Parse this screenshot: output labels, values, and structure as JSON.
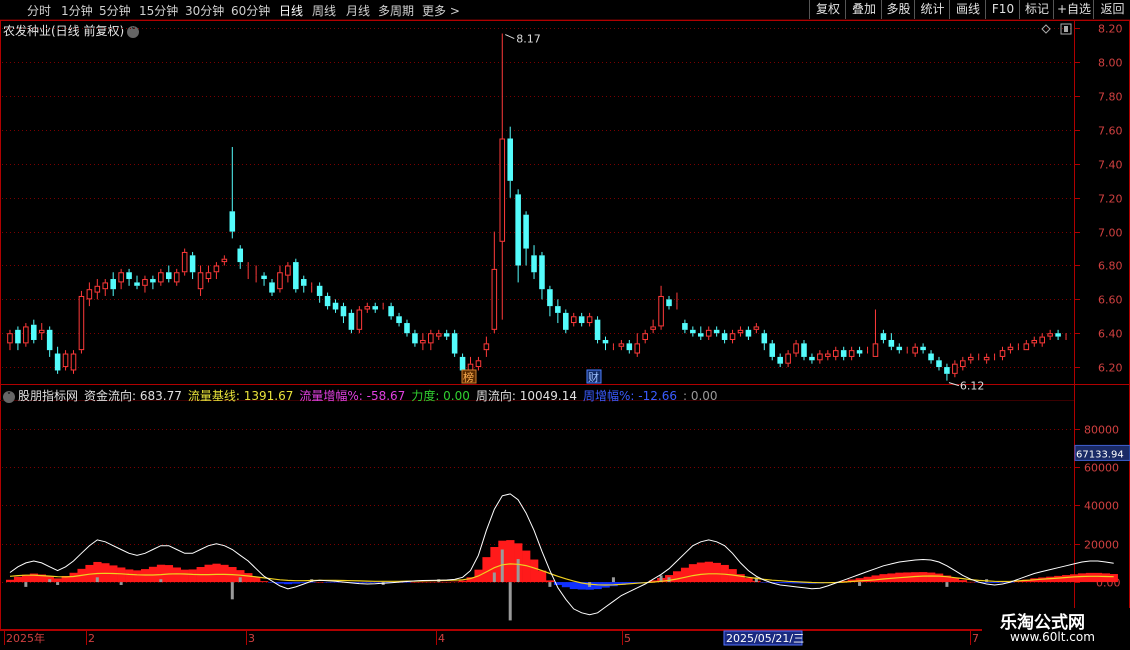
{
  "toolbar": {
    "periods": [
      "分时",
      "1分钟",
      "5分钟",
      "15分钟",
      "30分钟",
      "60分钟",
      "日线",
      "周线",
      "月线",
      "多周期",
      "更多 >"
    ],
    "active": "日线",
    "right_buttons": [
      "复权",
      "叠加",
      "多股",
      "统计",
      "画线",
      "F10",
      "标记",
      "+自选",
      "返回"
    ]
  },
  "stock_title": "农发种业(日线 前复权)",
  "price_axis": [
    "8.20",
    "8.00",
    "7.80",
    "7.60",
    "7.40",
    "7.20",
    "7.00",
    "6.80",
    "6.60",
    "6.40",
    "6.20"
  ],
  "high_label": "8.17",
  "low_label": "6.12",
  "badges": [
    "榜",
    "财"
  ],
  "indicator": {
    "name": "股朋指标网",
    "fields": [
      {
        "label": "资金流向: 683.77",
        "color": "#e0e0e0"
      },
      {
        "label": "流量基线: 1391.67",
        "color": "#e8e23a"
      },
      {
        "label": "流量增幅%: -58.67",
        "color": "#e040e0"
      },
      {
        "label": "力度: 0.00",
        "color": "#30d030"
      },
      {
        "label": "周流向: 10049.14",
        "color": "#e0e0e0"
      },
      {
        "label": "周增幅%: -12.66",
        "color": "#3a5cff"
      },
      {
        "label": ": 0.00",
        "color": "#999999"
      }
    ],
    "axis": [
      "80000",
      "60000",
      "40000",
      "20000",
      "0.00"
    ],
    "current_value": "67133.94"
  },
  "date_axis": {
    "labels": [
      "2025年",
      "2",
      "3",
      "4",
      "5",
      "7"
    ],
    "highlight": "2025/05/21/三"
  },
  "watermark": {
    "line1": "乐淘公式网",
    "line2": "www.60lt.com"
  },
  "colors": {
    "up": "#ff3a3a",
    "down": "#54fcfc",
    "grid": "#7a0000",
    "axis": "#b00000",
    "flow": "#ffffff",
    "base": "#f0d020"
  },
  "chart_data": {
    "type": "candlestick",
    "title": "农发种业(日线 前复权)",
    "ylim": [
      6.1,
      8.25
    ],
    "annotations": [
      {
        "label": "8.17",
        "value": 8.17
      },
      {
        "label": "6.12",
        "value": 6.12
      }
    ],
    "candles": [
      [
        6.34,
        6.4,
        6.42,
        6.3
      ],
      [
        6.42,
        6.34,
        6.44,
        6.3
      ],
      [
        6.34,
        6.44,
        6.46,
        6.32
      ],
      [
        6.45,
        6.36,
        6.48,
        6.34
      ],
      [
        6.4,
        6.42,
        6.46,
        6.36
      ],
      [
        6.42,
        6.3,
        6.44,
        6.26
      ],
      [
        6.28,
        6.18,
        6.32,
        6.16
      ],
      [
        6.2,
        6.28,
        6.3,
        6.18
      ],
      [
        6.18,
        6.28,
        6.3,
        6.16
      ],
      [
        6.3,
        6.62,
        6.65,
        6.28
      ],
      [
        6.6,
        6.66,
        6.7,
        6.56
      ],
      [
        6.64,
        6.68,
        6.72,
        6.6
      ],
      [
        6.66,
        6.7,
        6.72,
        6.62
      ],
      [
        6.72,
        6.66,
        6.76,
        6.62
      ],
      [
        6.7,
        6.76,
        6.78,
        6.66
      ],
      [
        6.76,
        6.72,
        6.78,
        6.68
      ],
      [
        6.7,
        6.68,
        6.74,
        6.66
      ],
      [
        6.68,
        6.72,
        6.74,
        6.64
      ],
      [
        6.72,
        6.7,
        6.74,
        6.66
      ],
      [
        6.7,
        6.76,
        6.78,
        6.68
      ],
      [
        6.76,
        6.72,
        6.8,
        6.7
      ],
      [
        6.7,
        6.76,
        6.78,
        6.68
      ],
      [
        6.76,
        6.88,
        6.9,
        6.74
      ],
      [
        6.86,
        6.76,
        6.88,
        6.72
      ],
      [
        6.66,
        6.76,
        6.8,
        6.62
      ],
      [
        6.72,
        6.76,
        6.8,
        6.7
      ],
      [
        6.76,
        6.8,
        6.82,
        6.72
      ],
      [
        6.82,
        6.84,
        6.86,
        6.8
      ],
      [
        7.12,
        7.0,
        7.5,
        6.96
      ],
      [
        6.9,
        6.82,
        6.92,
        6.78
      ],
      [
        6.78,
        6.78,
        6.82,
        6.72
      ],
      [
        6.74,
        6.74,
        6.8,
        6.7
      ],
      [
        6.74,
        6.72,
        6.76,
        6.68
      ],
      [
        6.7,
        6.64,
        6.72,
        6.62
      ],
      [
        6.66,
        6.76,
        6.8,
        6.64
      ],
      [
        6.74,
        6.8,
        6.82,
        6.7
      ],
      [
        6.82,
        6.66,
        6.84,
        6.64
      ],
      [
        6.72,
        6.68,
        6.74,
        6.64
      ],
      [
        6.68,
        6.68,
        6.7,
        6.64
      ],
      [
        6.68,
        6.62,
        6.7,
        6.58
      ],
      [
        6.62,
        6.56,
        6.64,
        6.54
      ],
      [
        6.58,
        6.54,
        6.6,
        6.52
      ],
      [
        6.56,
        6.5,
        6.58,
        6.46
      ],
      [
        6.52,
        6.42,
        6.54,
        6.4
      ],
      [
        6.42,
        6.54,
        6.56,
        6.4
      ],
      [
        6.54,
        6.56,
        6.58,
        6.52
      ],
      [
        6.56,
        6.54,
        6.58,
        6.52
      ],
      [
        6.56,
        6.56,
        6.58,
        6.54
      ],
      [
        6.56,
        6.5,
        6.58,
        6.48
      ],
      [
        6.5,
        6.46,
        6.52,
        6.44
      ],
      [
        6.46,
        6.4,
        6.48,
        6.38
      ],
      [
        6.4,
        6.34,
        6.42,
        6.32
      ],
      [
        6.34,
        6.36,
        6.4,
        6.3
      ],
      [
        6.34,
        6.4,
        6.42,
        6.3
      ],
      [
        6.38,
        6.4,
        6.42,
        6.36
      ],
      [
        6.4,
        6.38,
        6.42,
        6.36
      ],
      [
        6.4,
        6.28,
        6.42,
        6.26
      ],
      [
        6.26,
        6.18,
        6.28,
        6.16
      ],
      [
        6.18,
        6.22,
        6.26,
        6.16
      ],
      [
        6.2,
        6.24,
        6.26,
        6.18
      ],
      [
        6.3,
        6.34,
        6.38,
        6.26
      ],
      [
        6.42,
        6.78,
        7.0,
        6.4
      ],
      [
        6.94,
        7.55,
        8.17,
        6.48
      ],
      [
        7.55,
        7.3,
        7.62,
        7.2
      ],
      [
        7.22,
        6.8,
        7.25,
        6.7
      ],
      [
        7.1,
        6.9,
        7.12,
        6.8
      ],
      [
        6.86,
        6.76,
        6.92,
        6.72
      ],
      [
        6.86,
        6.66,
        6.88,
        6.6
      ],
      [
        6.66,
        6.56,
        6.68,
        6.5
      ],
      [
        6.56,
        6.52,
        6.6,
        6.46
      ],
      [
        6.52,
        6.42,
        6.54,
        6.4
      ],
      [
        6.46,
        6.5,
        6.52,
        6.44
      ],
      [
        6.5,
        6.46,
        6.52,
        6.44
      ],
      [
        6.46,
        6.5,
        6.52,
        6.44
      ],
      [
        6.48,
        6.36,
        6.5,
        6.34
      ],
      [
        6.36,
        6.34,
        6.38,
        6.3
      ],
      [
        6.32,
        6.32,
        6.34,
        6.3
      ],
      [
        6.32,
        6.34,
        6.36,
        6.3
      ],
      [
        6.34,
        6.3,
        6.36,
        6.28
      ],
      [
        6.28,
        6.34,
        6.4,
        6.26
      ],
      [
        6.36,
        6.4,
        6.42,
        6.34
      ],
      [
        6.42,
        6.44,
        6.48,
        6.4
      ],
      [
        6.44,
        6.62,
        6.68,
        6.42
      ],
      [
        6.6,
        6.56,
        6.62,
        6.54
      ],
      [
        6.58,
        6.58,
        6.64,
        6.54
      ],
      [
        6.46,
        6.42,
        6.48,
        6.4
      ],
      [
        6.42,
        6.4,
        6.44,
        6.38
      ],
      [
        6.4,
        6.38,
        6.44,
        6.36
      ],
      [
        6.38,
        6.42,
        6.44,
        6.36
      ],
      [
        6.42,
        6.4,
        6.44,
        6.38
      ],
      [
        6.4,
        6.36,
        6.42,
        6.34
      ],
      [
        6.36,
        6.4,
        6.42,
        6.34
      ],
      [
        6.4,
        6.42,
        6.44,
        6.38
      ],
      [
        6.42,
        6.38,
        6.44,
        6.36
      ],
      [
        6.42,
        6.44,
        6.46,
        6.4
      ],
      [
        6.4,
        6.34,
        6.42,
        6.3
      ],
      [
        6.34,
        6.26,
        6.36,
        6.24
      ],
      [
        6.26,
        6.22,
        6.28,
        6.2
      ],
      [
        6.22,
        6.28,
        6.3,
        6.2
      ],
      [
        6.28,
        6.34,
        6.36,
        6.26
      ],
      [
        6.34,
        6.26,
        6.36,
        6.24
      ],
      [
        6.26,
        6.24,
        6.28,
        6.22
      ],
      [
        6.24,
        6.28,
        6.3,
        6.22
      ],
      [
        6.26,
        6.28,
        6.3,
        6.24
      ],
      [
        6.26,
        6.3,
        6.32,
        6.24
      ],
      [
        6.3,
        6.26,
        6.32,
        6.24
      ],
      [
        6.26,
        6.3,
        6.32,
        6.24
      ],
      [
        6.3,
        6.28,
        6.32,
        6.26
      ],
      [
        6.3,
        6.3,
        6.32,
        6.28
      ],
      [
        6.26,
        6.34,
        6.54,
        6.26
      ],
      [
        6.4,
        6.36,
        6.42,
        6.34
      ],
      [
        6.36,
        6.32,
        6.4,
        6.3
      ],
      [
        6.32,
        6.3,
        6.34,
        6.28
      ],
      [
        6.3,
        6.3,
        6.32,
        6.28
      ],
      [
        6.28,
        6.32,
        6.34,
        6.26
      ],
      [
        6.32,
        6.3,
        6.34,
        6.28
      ],
      [
        6.28,
        6.24,
        6.3,
        6.22
      ],
      [
        6.24,
        6.2,
        6.26,
        6.18
      ],
      [
        6.2,
        6.16,
        6.22,
        6.12
      ],
      [
        6.16,
        6.22,
        6.24,
        6.14
      ],
      [
        6.2,
        6.24,
        6.26,
        6.18
      ],
      [
        6.24,
        6.26,
        6.28,
        6.22
      ],
      [
        6.26,
        6.26,
        6.28,
        6.24
      ],
      [
        6.24,
        6.26,
        6.28,
        6.22
      ],
      [
        6.26,
        6.26,
        6.28,
        6.24
      ],
      [
        6.26,
        6.3,
        6.32,
        6.24
      ],
      [
        6.3,
        6.32,
        6.34,
        6.28
      ],
      [
        6.32,
        6.32,
        6.34,
        6.3
      ],
      [
        6.3,
        6.34,
        6.36,
        6.3
      ],
      [
        6.34,
        6.36,
        6.38,
        6.32
      ],
      [
        6.34,
        6.38,
        6.4,
        6.32
      ],
      [
        6.38,
        6.4,
        6.42,
        6.36
      ],
      [
        6.4,
        6.38,
        6.42,
        6.36
      ],
      [
        6.38,
        6.38,
        6.4,
        6.36
      ]
    ],
    "indicator": {
      "ylim": [
        -25000,
        95000
      ],
      "flow": [
        5000,
        8000,
        10000,
        11000,
        10000,
        8000,
        6000,
        8000,
        11000,
        15000,
        19000,
        22000,
        21000,
        19000,
        17000,
        15000,
        14000,
        15000,
        17000,
        19000,
        19000,
        17000,
        15000,
        15000,
        17000,
        19000,
        20000,
        19000,
        17000,
        14000,
        11000,
        7000,
        3000,
        500,
        -2000,
        -3500,
        -2500,
        -1000,
        500,
        1000,
        700,
        400,
        0,
        -400,
        -800,
        -1000,
        -900,
        -600,
        -300,
        0,
        300,
        600,
        800,
        900,
        1000,
        1100,
        1400,
        2500,
        6000,
        14000,
        27000,
        38000,
        45000,
        46000,
        43000,
        36000,
        27000,
        16000,
        6000,
        -3000,
        -9000,
        -14000,
        -16000,
        -17000,
        -16000,
        -13000,
        -10000,
        -7000,
        -5000,
        -3000,
        -1000,
        1500,
        4000,
        7000,
        11000,
        15000,
        19000,
        21000,
        22000,
        21000,
        19000,
        15000,
        10000,
        6000,
        3000,
        1000,
        -500,
        -1500,
        -2000,
        -2500,
        -3000,
        -3500,
        -3200,
        -2000,
        -500,
        1000,
        2500,
        4000,
        5500,
        7000,
        8500,
        9500,
        10500,
        11000,
        11500,
        11800,
        11500,
        10500,
        8500,
        6000,
        3500,
        1500,
        0,
        -1000,
        -1500,
        -1000,
        0,
        1500,
        3000,
        4500,
        5500,
        6500,
        7500,
        8500,
        9500,
        10500,
        11000,
        11000,
        10500,
        9800
      ],
      "base": [
        3000,
        3400,
        3600,
        3600,
        3400,
        3100,
        2800,
        2700,
        2900,
        3500,
        4100,
        4500,
        4600,
        4500,
        4300,
        4000,
        3800,
        3700,
        3700,
        3900,
        4200,
        4300,
        4200,
        4000,
        3900,
        3900,
        4000,
        4000,
        3900,
        3600,
        3200,
        2700,
        2200,
        1700,
        1200,
        900,
        700,
        700,
        800,
        900,
        900,
        900,
        800,
        700,
        600,
        500,
        400,
        400,
        400,
        400,
        500,
        500,
        600,
        700,
        800,
        900,
        1000,
        1200,
        1800,
        3200,
        5300,
        7500,
        9000,
        9500,
        9300,
        8600,
        7400,
        6000,
        4500,
        3000,
        1700,
        500,
        -500,
        -1100,
        -1400,
        -1500,
        -1400,
        -1200,
        -900,
        -600,
        -300,
        0,
        400,
        900,
        1600,
        2500,
        3400,
        4000,
        4300,
        4300,
        4100,
        3700,
        3100,
        2500,
        1900,
        1400,
        1000,
        700,
        400,
        200,
        0,
        -200,
        -300,
        -300,
        -200,
        0,
        300,
        600,
        900,
        1200,
        1600,
        2000,
        2300,
        2600,
        2900,
        3100,
        3200,
        3100,
        2800,
        2300,
        1800,
        1300,
        900,
        600,
        400,
        300,
        400,
        600,
        900,
        1200,
        1500,
        1800,
        2100,
        2400,
        2700,
        2900,
        3000,
        3000,
        2900,
        2800
      ],
      "bars": [
        0,
        0,
        -2500,
        0,
        0,
        1500,
        -1500,
        0,
        0,
        0,
        0,
        2500,
        0,
        0,
        -1500,
        0,
        0,
        0,
        0,
        1500,
        0,
        0,
        0,
        0,
        0,
        0,
        0,
        0,
        -9000,
        2500,
        0,
        0,
        0,
        0,
        0,
        0,
        0,
        0,
        1500,
        0,
        0,
        0,
        0,
        0,
        0,
        0,
        0,
        -1500,
        0,
        0,
        0,
        0,
        0,
        0,
        1500,
        0,
        0,
        0,
        0,
        0,
        0,
        5000,
        17000,
        -20000,
        12000,
        0,
        0,
        0,
        -2500,
        0,
        0,
        0,
        0,
        -2500,
        0,
        0,
        2500,
        0,
        0,
        0,
        0,
        0,
        3500,
        2500,
        0,
        0,
        0,
        0,
        0,
        0,
        0,
        0,
        0,
        0,
        2500,
        0,
        0,
        0,
        0,
        0,
        0,
        0,
        0,
        0,
        0,
        0,
        0,
        -2000,
        0,
        0,
        0,
        0,
        0,
        0,
        0,
        0,
        0,
        0,
        -2500,
        0,
        0,
        0,
        0,
        1500,
        0,
        0,
        0,
        0,
        0,
        0,
        0,
        0,
        0,
        0,
        0,
        0,
        0,
        0,
        0,
        0,
        0,
        0
      ]
    }
  }
}
